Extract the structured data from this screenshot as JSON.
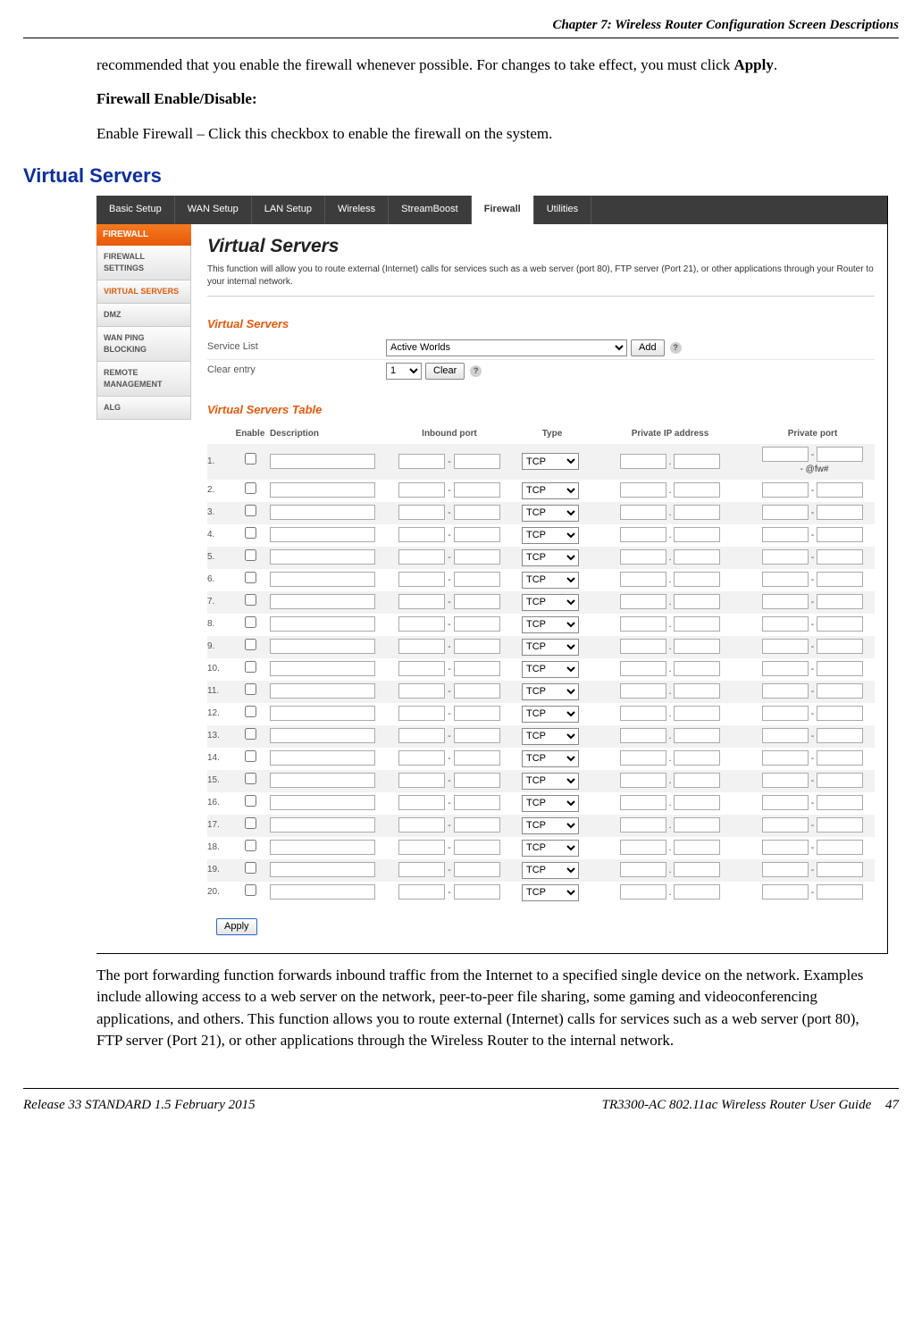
{
  "header": {
    "chapter": "Chapter 7: Wireless Router Configuration Screen Descriptions"
  },
  "intro": {
    "p1a": "recommended that you enable the firewall whenever possible.  For changes to take effect, you must click ",
    "p1b": "Apply",
    "p1c": ".",
    "h": "Firewall Enable/Disable:",
    "p2": "Enable Firewall – Click this checkbox to enable the firewall on the system."
  },
  "section_heading": "Virtual Servers",
  "router": {
    "tabs": [
      "Basic Setup",
      "WAN Setup",
      "LAN Setup",
      "Wireless",
      "StreamBoost",
      "Firewall",
      "Utilities"
    ],
    "active_tab": 5,
    "side_title": "FIREWALL",
    "side_items": [
      "FIREWALL SETTINGS",
      "VIRTUAL SERVERS",
      "DMZ",
      "WAN PING BLOCKING",
      "REMOTE MANAGEMENT",
      "ALG"
    ],
    "side_active": 1,
    "page_title": "Virtual Servers",
    "page_desc": "This function will allow you to route external (Internet) calls for services such as a web server (port 80), FTP server (Port 21), or other applications through your Router to your internal network.",
    "sub1": "Virtual Servers",
    "service_list_label": "Service List",
    "service_list_value": "Active Worlds",
    "add_btn": "Add",
    "clear_label": "Clear entry",
    "clear_value": "1",
    "clear_btn": "Clear",
    "sub2": "Virtual Servers Table",
    "cols": {
      "enable": "Enable",
      "desc": "Description",
      "inbound": "Inbound port",
      "type": "Type",
      "pip": "Private IP address",
      "pp": "Private port"
    },
    "type_value": "TCP",
    "suffix1": "- @fw#",
    "row_count": 20,
    "apply": "Apply"
  },
  "after": "The port forwarding function forwards inbound traffic from the Internet to a specified single device on the network.  Examples include allowing access to a web server on the network, peer-to-peer file sharing, some gaming and videoconferencing applications, and others.  This function allows you to route external (Internet) calls for services such as a web server (port 80), FTP server (Port 21), or other applications through the Wireless Router to the internal network.",
  "footer": {
    "left": "Release 33 STANDARD 1.5    February 2015",
    "right": "TR3300-AC 802.11ac Wireless Router User Guide",
    "page": "47"
  }
}
